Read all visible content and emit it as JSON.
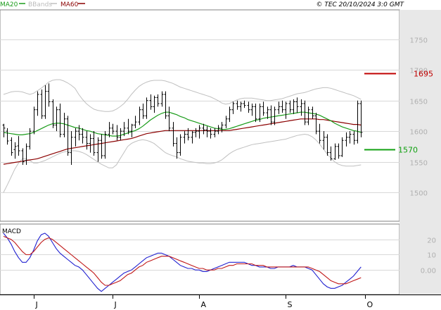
{
  "header": {
    "legend": [
      {
        "name": "MA20",
        "color": "#1a9c1a"
      },
      {
        "name": "BBands",
        "color": "#c0c0c0"
      },
      {
        "name": "MA60",
        "color": "#8b0000"
      }
    ],
    "copyright": "© TEC 20/10/2024 3:0 GMT"
  },
  "chart_data": [
    {
      "type": "ohlc",
      "panel": "price",
      "y_ticks": [
        1500,
        1550,
        1600,
        1650,
        1700,
        1750
      ],
      "ylim": [
        1453,
        1798
      ],
      "grid": true,
      "month_labels": [
        {
          "label": "J",
          "bar": 8
        },
        {
          "label": "J",
          "bar": 29
        },
        {
          "label": "A",
          "bar": 52
        },
        {
          "label": "S",
          "bar": 75
        },
        {
          "label": "O",
          "bar": 96
        }
      ],
      "resistance": {
        "value": 1695,
        "label": "1695",
        "color": "#c00000"
      },
      "support": {
        "value": 1570,
        "label": "1570",
        "color": "#10a010"
      },
      "bars": [
        [
          1610,
          1612,
          1590,
          1605
        ],
        [
          1600,
          1605,
          1578,
          1584
        ],
        [
          1585,
          1590,
          1560,
          1565
        ],
        [
          1570,
          1582,
          1555,
          1575
        ],
        [
          1576,
          1592,
          1560,
          1568
        ],
        [
          1568,
          1572,
          1545,
          1550
        ],
        [
          1552,
          1580,
          1545,
          1575
        ],
        [
          1575,
          1605,
          1570,
          1600
        ],
        [
          1600,
          1640,
          1595,
          1635
        ],
        [
          1635,
          1665,
          1625,
          1660
        ],
        [
          1660,
          1668,
          1620,
          1625
        ],
        [
          1625,
          1675,
          1620,
          1665
        ],
        [
          1665,
          1678,
          1640,
          1648
        ],
        [
          1648,
          1652,
          1605,
          1610
        ],
        [
          1610,
          1640,
          1600,
          1635
        ],
        [
          1635,
          1645,
          1590,
          1595
        ],
        [
          1595,
          1630,
          1590,
          1620
        ],
        [
          1620,
          1625,
          1560,
          1565
        ],
        [
          1565,
          1600,
          1545,
          1590
        ],
        [
          1590,
          1605,
          1575,
          1600
        ],
        [
          1600,
          1610,
          1585,
          1595
        ],
        [
          1595,
          1605,
          1580,
          1590
        ],
        [
          1590,
          1600,
          1570,
          1580
        ],
        [
          1580,
          1595,
          1565,
          1588
        ],
        [
          1588,
          1600,
          1560,
          1565
        ],
        [
          1565,
          1590,
          1550,
          1585
        ],
        [
          1585,
          1595,
          1555,
          1560
        ],
        [
          1560,
          1600,
          1555,
          1595
        ],
        [
          1595,
          1615,
          1590,
          1605
        ],
        [
          1605,
          1612,
          1595,
          1600
        ],
        [
          1600,
          1610,
          1585,
          1590
        ],
        [
          1590,
          1605,
          1585,
          1600
        ],
        [
          1600,
          1615,
          1592,
          1605
        ],
        [
          1605,
          1620,
          1595,
          1600
        ],
        [
          1600,
          1612,
          1590,
          1610
        ],
        [
          1610,
          1625,
          1605,
          1615
        ],
        [
          1615,
          1640,
          1610,
          1635
        ],
        [
          1635,
          1645,
          1620,
          1625
        ],
        [
          1625,
          1655,
          1620,
          1650
        ],
        [
          1650,
          1660,
          1635,
          1640
        ],
        [
          1640,
          1658,
          1630,
          1655
        ],
        [
          1655,
          1660,
          1640,
          1645
        ],
        [
          1645,
          1665,
          1640,
          1660
        ],
        [
          1660,
          1665,
          1620,
          1625
        ],
        [
          1625,
          1640,
          1600,
          1605
        ],
        [
          1605,
          1615,
          1575,
          1580
        ],
        [
          1580,
          1590,
          1555,
          1565
        ],
        [
          1565,
          1595,
          1560,
          1590
        ],
        [
          1590,
          1600,
          1580,
          1595
        ],
        [
          1595,
          1605,
          1585,
          1590
        ],
        [
          1590,
          1600,
          1580,
          1598
        ],
        [
          1598,
          1605,
          1590,
          1600
        ],
        [
          1600,
          1610,
          1588,
          1605
        ],
        [
          1605,
          1612,
          1595,
          1602
        ],
        [
          1602,
          1608,
          1590,
          1600
        ],
        [
          1600,
          1605,
          1588,
          1595
        ],
        [
          1595,
          1605,
          1590,
          1600
        ],
        [
          1600,
          1610,
          1595,
          1605
        ],
        [
          1605,
          1615,
          1598,
          1610
        ],
        [
          1610,
          1625,
          1605,
          1620
        ],
        [
          1620,
          1640,
          1615,
          1635
        ],
        [
          1635,
          1648,
          1628,
          1645
        ],
        [
          1645,
          1650,
          1635,
          1640
        ],
        [
          1640,
          1648,
          1632,
          1645
        ],
        [
          1645,
          1650,
          1638,
          1642
        ],
        [
          1642,
          1648,
          1630,
          1635
        ],
        [
          1635,
          1645,
          1625,
          1640
        ],
        [
          1640,
          1645,
          1615,
          1620
        ],
        [
          1620,
          1645,
          1615,
          1640
        ],
        [
          1640,
          1648,
          1625,
          1630
        ],
        [
          1630,
          1640,
          1620,
          1635
        ],
        [
          1635,
          1642,
          1610,
          1615
        ],
        [
          1615,
          1640,
          1610,
          1635
        ],
        [
          1635,
          1648,
          1628,
          1640
        ],
        [
          1640,
          1650,
          1630,
          1635
        ],
        [
          1635,
          1648,
          1620,
          1645
        ],
        [
          1645,
          1650,
          1630,
          1635
        ],
        [
          1635,
          1652,
          1628,
          1648
        ],
        [
          1648,
          1655,
          1630,
          1640
        ],
        [
          1640,
          1652,
          1625,
          1645
        ],
        [
          1645,
          1650,
          1610,
          1615
        ],
        [
          1615,
          1640,
          1610,
          1635
        ],
        [
          1635,
          1640,
          1620,
          1625
        ],
        [
          1625,
          1630,
          1595,
          1600
        ],
        [
          1600,
          1612,
          1580,
          1585
        ],
        [
          1585,
          1600,
          1570,
          1590
        ],
        [
          1590,
          1595,
          1560,
          1565
        ],
        [
          1565,
          1575,
          1552,
          1555
        ],
        [
          1555,
          1580,
          1553,
          1575
        ],
        [
          1575,
          1580,
          1555,
          1560
        ],
        [
          1560,
          1590,
          1558,
          1585
        ],
        [
          1585,
          1598,
          1575,
          1590
        ],
        [
          1590,
          1600,
          1580,
          1595
        ],
        [
          1595,
          1600,
          1578,
          1585
        ],
        [
          1585,
          1650,
          1580,
          1645
        ],
        [
          1645,
          1650,
          1590,
          1598
        ]
      ],
      "ma20": [
        1598,
        1597,
        1596,
        1595,
        1594,
        1594,
        1595,
        1596,
        1598,
        1601,
        1604,
        1607,
        1610,
        1612,
        1613,
        1613,
        1612,
        1610,
        1608,
        1606,
        1605,
        1603,
        1601,
        1600,
        1598,
        1596,
        1595,
        1594,
        1593,
        1592,
        1592,
        1593,
        1595,
        1597,
        1599,
        1601,
        1604,
        1608,
        1613,
        1618,
        1622,
        1626,
        1629,
        1631,
        1631,
        1629,
        1627,
        1624,
        1622,
        1619,
        1617,
        1615,
        1613,
        1611,
        1609,
        1607,
        1605,
        1604,
        1603,
        1603,
        1604,
        1606,
        1608,
        1610,
        1612,
        1614,
        1616,
        1618,
        1619,
        1621,
        1622,
        1623,
        1624,
        1625,
        1626,
        1627,
        1628,
        1629,
        1630,
        1631,
        1631,
        1630,
        1629,
        1628,
        1626,
        1623,
        1620,
        1617,
        1613,
        1610,
        1607,
        1605,
        1603,
        1601,
        1600,
        1598
      ],
      "bb_upper": [
        1660,
        1662,
        1664,
        1665,
        1665,
        1664,
        1662,
        1660,
        1662,
        1666,
        1670,
        1675,
        1680,
        1683,
        1684,
        1684,
        1682,
        1679,
        1675,
        1670,
        1660,
        1652,
        1645,
        1640,
        1636,
        1634,
        1633,
        1632,
        1632,
        1633,
        1636,
        1640,
        1645,
        1652,
        1660,
        1667,
        1673,
        1677,
        1680,
        1682,
        1683,
        1683,
        1683,
        1682,
        1680,
        1678,
        1675,
        1672,
        1670,
        1668,
        1666,
        1664,
        1662,
        1660,
        1658,
        1656,
        1653,
        1650,
        1646,
        1644,
        1645,
        1648,
        1651,
        1653,
        1654,
        1654,
        1654,
        1653,
        1652,
        1651,
        1650,
        1650,
        1651,
        1652,
        1653,
        1655,
        1657,
        1659,
        1661,
        1662,
        1663,
        1665,
        1667,
        1669,
        1670,
        1671,
        1671,
        1670,
        1668,
        1666,
        1664,
        1662,
        1660,
        1658,
        1655,
        1652
      ],
      "bb_lower": [
        1500,
        1512,
        1525,
        1538,
        1548,
        1555,
        1555,
        1552,
        1548,
        1548,
        1550,
        1552,
        1555,
        1558,
        1561,
        1564,
        1566,
        1567,
        1568,
        1568,
        1567,
        1565,
        1562,
        1558,
        1554,
        1550,
        1546,
        1543,
        1540,
        1540,
        1545,
        1555,
        1565,
        1575,
        1580,
        1583,
        1585,
        1586,
        1585,
        1583,
        1580,
        1575,
        1570,
        1565,
        1562,
        1560,
        1558,
        1555,
        1553,
        1551,
        1550,
        1549,
        1548,
        1548,
        1547,
        1547,
        1548,
        1550,
        1553,
        1558,
        1563,
        1567,
        1570,
        1572,
        1574,
        1576,
        1578,
        1579,
        1580,
        1581,
        1582,
        1583,
        1584,
        1585,
        1586,
        1587,
        1589,
        1591,
        1593,
        1594,
        1595,
        1594,
        1591,
        1586,
        1579,
        1571,
        1563,
        1556,
        1550,
        1546,
        1544,
        1543,
        1543,
        1543,
        1544,
        1545
      ],
      "ma60": [
        1546,
        1547,
        1548,
        1549,
        1550,
        1551,
        1552,
        1553,
        1554,
        1555,
        1557,
        1559,
        1561,
        1563,
        1565,
        1567,
        1569,
        1571,
        1572,
        1573,
        1574,
        1575,
        1576,
        1577,
        1578,
        1579,
        1580,
        1581,
        1582,
        1583,
        1584,
        1585,
        1586,
        1587,
        1588,
        1590,
        1592,
        1594,
        1596,
        1597,
        1598,
        1599,
        1600,
        1601,
        1601,
        1601,
        1601,
        1601,
        1601,
        1601,
        1601,
        1601,
        1601,
        1601,
        1601,
        1601,
        1601,
        1601,
        1601,
        1601,
        1601,
        1602,
        1603,
        1604,
        1605,
        1606,
        1607,
        1608,
        1609,
        1610,
        1611,
        1612,
        1613,
        1614,
        1615,
        1616,
        1617,
        1618,
        1619,
        1620,
        1620,
        1620,
        1620,
        1620,
        1619,
        1619,
        1618,
        1617,
        1616,
        1615,
        1614,
        1613,
        1612,
        1611,
        1611,
        1610
      ]
    },
    {
      "type": "line",
      "panel": "macd",
      "title": "MACD",
      "y_ticks": [
        0,
        10,
        20
      ],
      "y_tick_labels": [
        "0.00",
        "10",
        "20"
      ],
      "ylim": [
        -16,
        30
      ],
      "grid": true,
      "series": [
        {
          "name": "MACD",
          "color": "#2020d0",
          "values": [
            24,
            21,
            17,
            12,
            8,
            5,
            5,
            8,
            13,
            19,
            23,
            24,
            22,
            18,
            14,
            11,
            9,
            7,
            5,
            3,
            2,
            0,
            -3,
            -6,
            -9,
            -12,
            -14,
            -12,
            -10,
            -8,
            -6,
            -4,
            -2,
            -1,
            0,
            2,
            4,
            6,
            8,
            9,
            10,
            11,
            11,
            10,
            9,
            7,
            5,
            3,
            2,
            1,
            1,
            0,
            0,
            -1,
            -1,
            0,
            1,
            2,
            3,
            4,
            5,
            5,
            5,
            5,
            5,
            4,
            3,
            3,
            2,
            2,
            2,
            1,
            1,
            2,
            2,
            2,
            2,
            3,
            2,
            2,
            2,
            1,
            0,
            -3,
            -6,
            -9,
            -11,
            -12,
            -12,
            -11,
            -10,
            -8,
            -6,
            -4,
            -1,
            2
          ]
        },
        {
          "name": "Signal",
          "color": "#c01818",
          "values": [
            22,
            21,
            20,
            18,
            15,
            12,
            10,
            10,
            12,
            15,
            18,
            20,
            21,
            20,
            18,
            16,
            14,
            12,
            10,
            8,
            6,
            4,
            2,
            0,
            -2,
            -5,
            -8,
            -10,
            -10,
            -9,
            -8,
            -7,
            -5,
            -3,
            -2,
            0,
            2,
            3,
            5,
            6,
            7,
            8,
            9,
            9,
            9,
            8,
            7,
            6,
            5,
            4,
            3,
            2,
            1,
            1,
            0,
            0,
            0,
            1,
            1,
            2,
            3,
            3,
            4,
            4,
            4,
            4,
            4,
            3,
            3,
            3,
            2,
            2,
            2,
            2,
            2,
            2,
            2,
            2,
            2,
            2,
            2,
            2,
            1,
            0,
            -1,
            -3,
            -5,
            -7,
            -8,
            -9,
            -9,
            -9,
            -8,
            -7,
            -6,
            -5
          ]
        }
      ]
    }
  ]
}
